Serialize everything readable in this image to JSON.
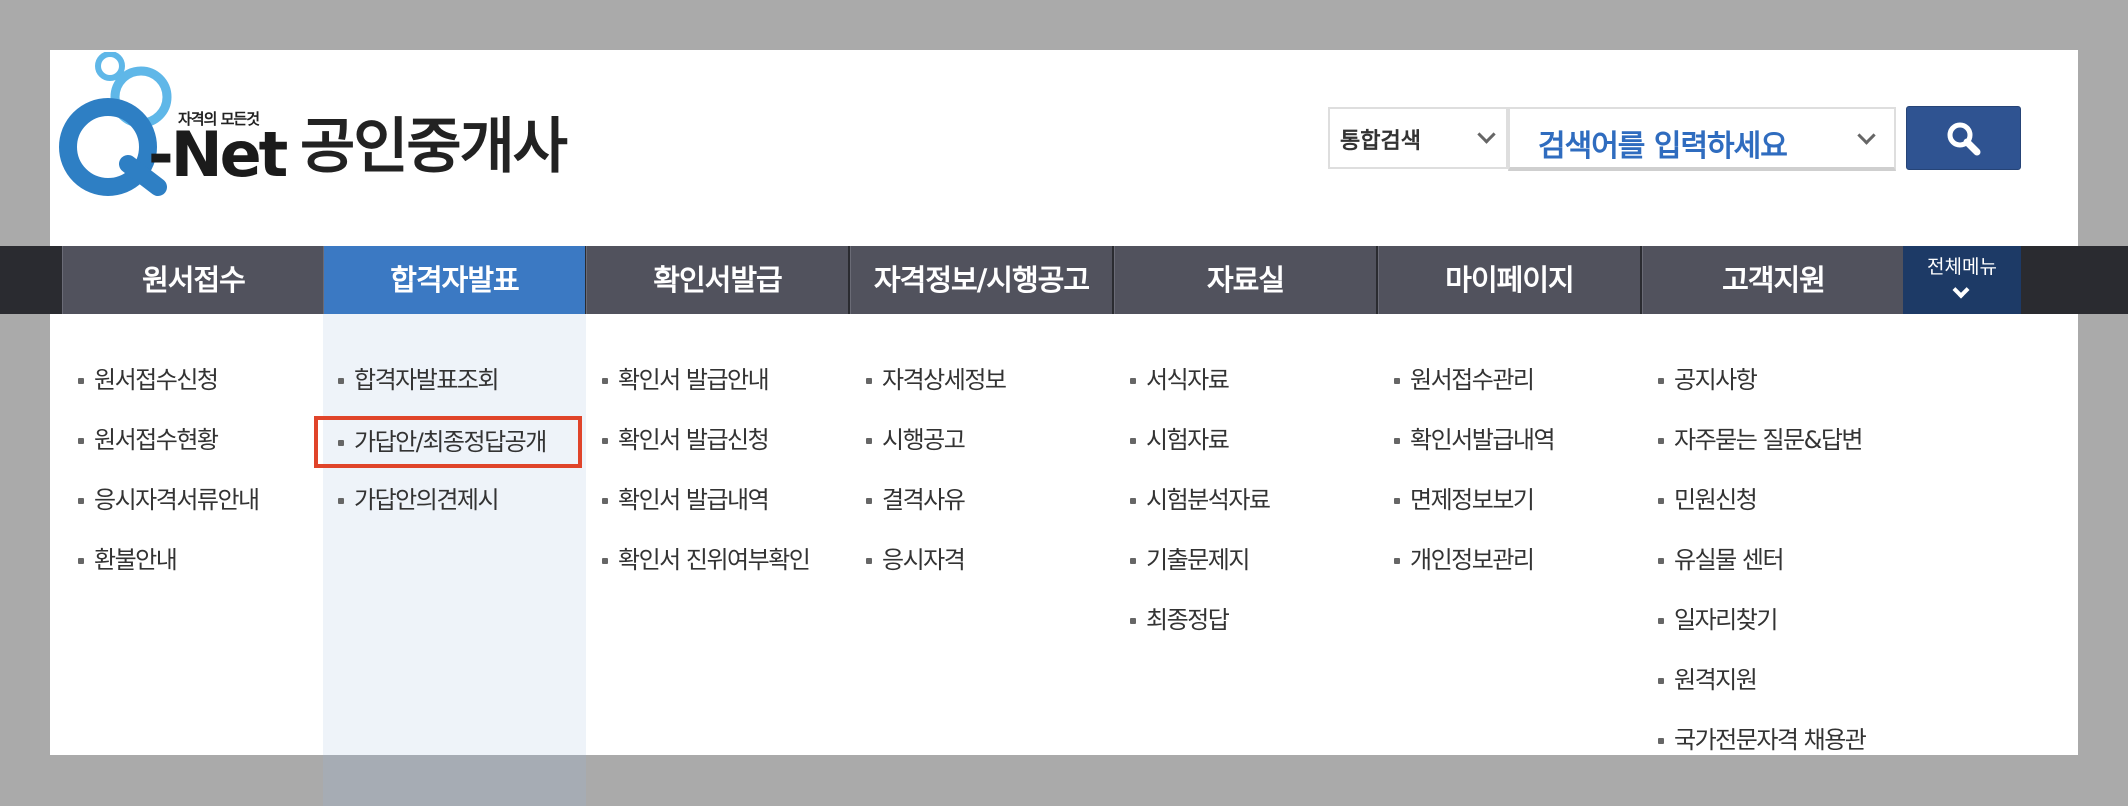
{
  "header": {
    "logo": {
      "tagline": "자격의 모든것",
      "name": "-Net"
    },
    "site_title": "공인중개사"
  },
  "search": {
    "scope_label": "통합검색",
    "placeholder": "검색어를 입력하세요",
    "button_icon": "search-icon"
  },
  "colors": {
    "nav_bg": "#51525d",
    "nav_active": "#3b79c3",
    "all_menu_bg": "#1d3a66",
    "search_button": "#2f5391",
    "highlight_outline": "#e0442a"
  },
  "nav": {
    "items": [
      {
        "label": "원서접수",
        "active": false
      },
      {
        "label": "합격자발표",
        "active": true
      },
      {
        "label": "확인서발급",
        "active": false
      },
      {
        "label": "자격정보/시행공고",
        "active": false
      },
      {
        "label": "자료실",
        "active": false
      },
      {
        "label": "마이페이지",
        "active": false
      },
      {
        "label": "고객지원",
        "active": false
      }
    ],
    "all_menu_label": "전체메뉴"
  },
  "menu": {
    "columns": [
      {
        "items": [
          "원서접수신청",
          "원서접수현황",
          "응시자격서류안내",
          "환불안내"
        ]
      },
      {
        "items": [
          "합격자발표조회",
          "가답안/최종정답공개",
          "가답안의견제시"
        ],
        "highlighted_index": 1
      },
      {
        "items": [
          "확인서 발급안내",
          "확인서 발급신청",
          "확인서 발급내역",
          "확인서 진위여부확인"
        ]
      },
      {
        "items": [
          "자격상세정보",
          "시행공고",
          "결격사유",
          "응시자격"
        ]
      },
      {
        "items": [
          "서식자료",
          "시험자료",
          "시험분석자료",
          "기출문제지",
          "최종정답"
        ]
      },
      {
        "items": [
          "원서접수관리",
          "확인서발급내역",
          "면제정보보기",
          "개인정보관리"
        ]
      },
      {
        "items": [
          "공지사항",
          "자주묻는 질문&답변",
          "민원신청",
          "유실물 센터",
          "일자리찾기",
          "원격지원",
          "국가전문자격 채용관"
        ]
      }
    ]
  }
}
